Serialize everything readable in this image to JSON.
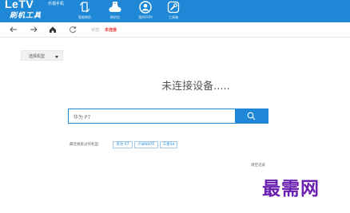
{
  "header": {
    "brand": "LeTV",
    "brand_small": "乐视手机",
    "tool_name": "刷机工具",
    "nav": [
      {
        "label": "智能刷机",
        "icon": "phone-refresh-icon"
      },
      {
        "label": "刷机包",
        "icon": "cloud-rom-icon"
      },
      {
        "label": "我的ROM",
        "icon": "user-icon"
      },
      {
        "label": "工具箱",
        "icon": "wrench-icon"
      }
    ]
  },
  "toolbar": {
    "status_label": "状态:",
    "status_value": "未连接"
  },
  "main": {
    "model_select_label": "选择机型",
    "headline": "未连接设备.....",
    "search_value": "华为 P7",
    "recent_label": "最近搜索过的机型:",
    "recent_models": [
      "华为 P7",
      "小米NOTE",
      "三星S4"
    ],
    "clear_history": "清空记录"
  },
  "watermark": "最需网",
  "colors": {
    "primary": "#1e88d6",
    "status_red": "#e53935",
    "watermark": "#6a1fb0"
  }
}
